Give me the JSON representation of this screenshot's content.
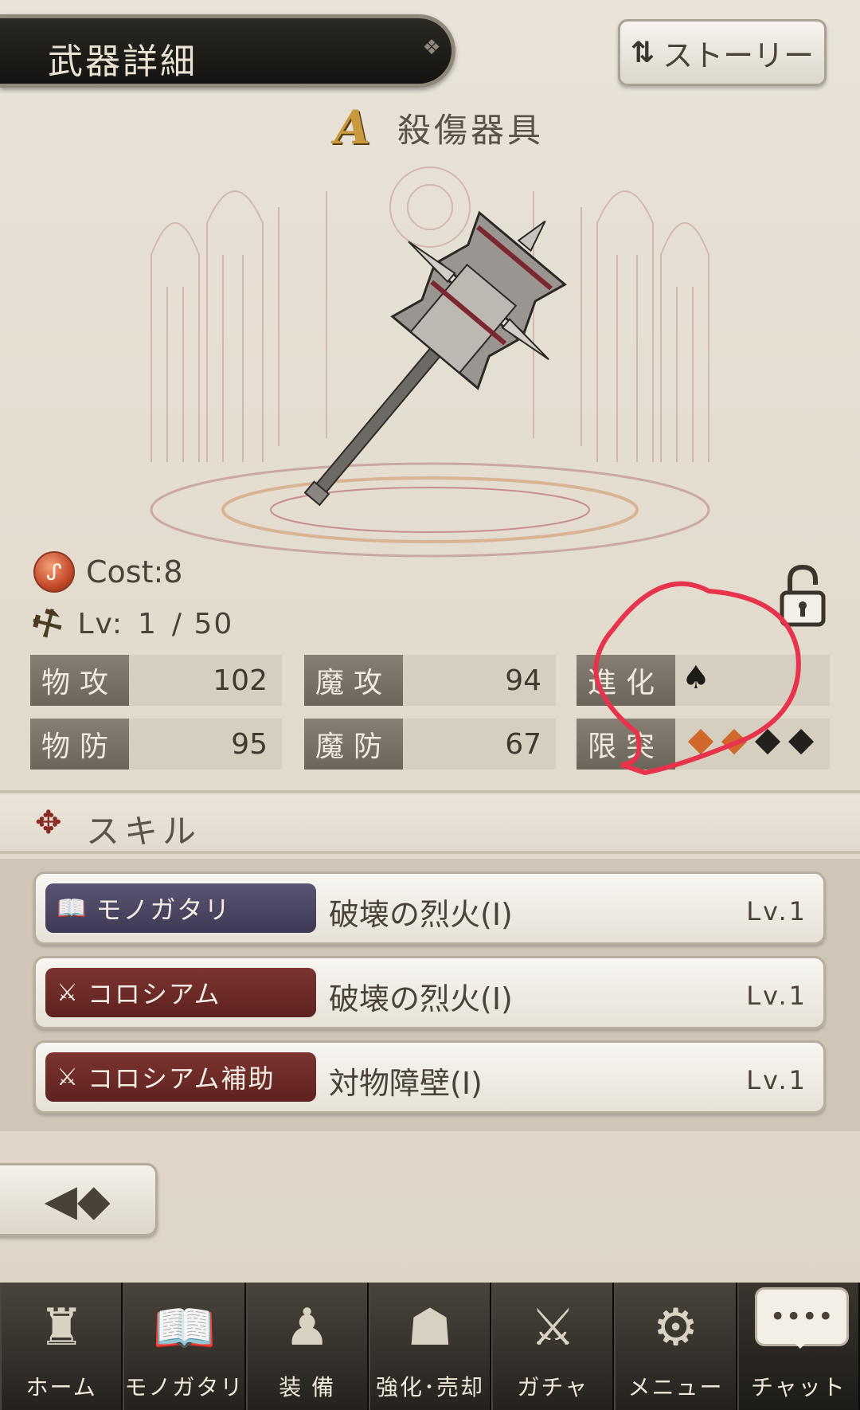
{
  "header": {
    "title": "武器詳細",
    "story_button": {
      "icon": "swap-arrows-icon",
      "label": "ストーリー"
    }
  },
  "weapon": {
    "rank": "A",
    "name": "殺傷器具",
    "cost": "Cost:8",
    "level": {
      "prefix": "Lv:",
      "current": "1",
      "max": "/ 50"
    },
    "lock_state": "unlocked"
  },
  "stats": {
    "phys_atk": {
      "label": "物攻",
      "value": "102"
    },
    "mag_atk": {
      "label": "魔攻",
      "value": "94"
    },
    "phys_def": {
      "label": "物防",
      "value": "95"
    },
    "mag_def": {
      "label": "魔防",
      "value": "67"
    },
    "evolution": {
      "label": "進化",
      "icon": "spade-icon",
      "stage": 1
    },
    "limit": {
      "label": "限突",
      "filled": 2,
      "total": 4
    }
  },
  "skills": {
    "title": "スキル",
    "rows": [
      {
        "tag": "モノガタリ",
        "tag_icon": "book-icon",
        "name": "破壊の烈火(Ⅰ)",
        "lv": "Lv.1",
        "style": "story"
      },
      {
        "tag": "コロシアム",
        "tag_icon": "crossed-swords-icon",
        "name": "破壊の烈火(Ⅰ)",
        "lv": "Lv.1",
        "style": "colo"
      },
      {
        "tag": "コロシアム補助",
        "tag_icon": "crossed-swords-support-icon",
        "name": "対物障壁(Ⅰ)",
        "lv": "Lv.1",
        "style": "colo"
      }
    ]
  },
  "nav": [
    {
      "label": "ホーム",
      "icon": "castle-icon"
    },
    {
      "label": "モノガタリ",
      "icon": "open-book-icon"
    },
    {
      "label": "装 備",
      "icon": "puppet-icon"
    },
    {
      "label": "強化･売却",
      "icon": "mask-icon"
    },
    {
      "label": "ガチャ",
      "icon": "swords-icon"
    },
    {
      "label": "メニュー",
      "icon": "gears-icon"
    },
    {
      "label": "チャット",
      "icon": "chat-bubble-icon"
    }
  ],
  "colors": {
    "annotation": "#e8334d",
    "limit_filled": "#d0672b",
    "accent_dark": "#1a1816"
  }
}
